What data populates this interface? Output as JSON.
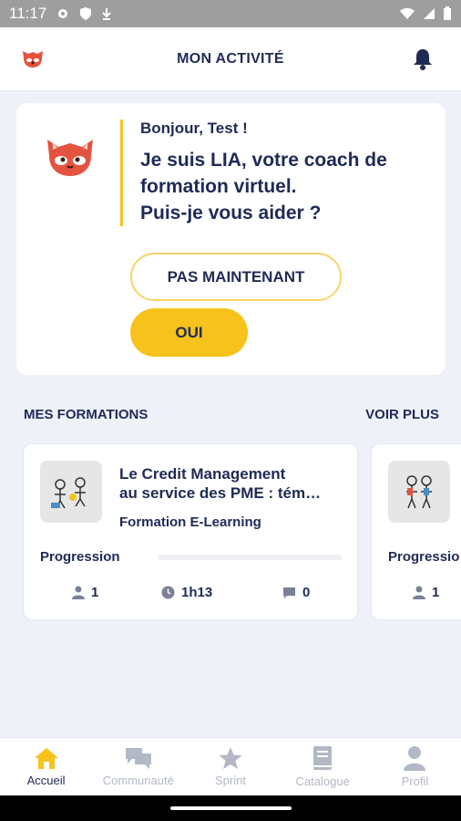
{
  "status_bar": {
    "time": "11:17",
    "icons": [
      "gear-icon",
      "shield-icon",
      "download-icon",
      "wifi-icon",
      "signal-icon",
      "battery-icon"
    ]
  },
  "header": {
    "title": "MON ACTIVITÉ",
    "logo_icon": "red-panda-logo",
    "notification_icon": "bell-icon"
  },
  "coach": {
    "greeting": "Bonjour, Test !",
    "message_line1": "Je suis LIA, votre coach de",
    "message_line2": "formation virtuel.",
    "message_line3": "Puis-je vous aider ?",
    "later_button": "PAS MAINTENANT",
    "yes_button": "OUI"
  },
  "formations": {
    "section_title": "MES FORMATIONS",
    "see_more": "VOIR PLUS",
    "cards": [
      {
        "title_line1": "Le Credit Management",
        "title_line2": "au service des PME : tém…",
        "type": "Formation E-Learning",
        "progress_label": "Progression",
        "progress": 0,
        "learners": "1",
        "duration": "1h13",
        "comments": "0"
      },
      {
        "title_line1": "",
        "title_line2": "",
        "type": "",
        "progress_label": "Progressio",
        "progress": 0,
        "learners": "1",
        "duration": "",
        "comments": ""
      }
    ]
  },
  "bottom_nav": {
    "items": [
      {
        "label": "Accueil",
        "icon": "home-icon",
        "active": true
      },
      {
        "label": "Communauté",
        "icon": "chat-icon",
        "active": false
      },
      {
        "label": "Sprint",
        "icon": "star-icon",
        "active": false
      },
      {
        "label": "Catalogue",
        "icon": "book-icon",
        "active": false
      },
      {
        "label": "Profil",
        "icon": "person-icon",
        "active": false
      }
    ]
  },
  "colors": {
    "accent": "#f7c21b",
    "text": "#1f2a56",
    "background": "#eef2f8",
    "inactive": "#b3b8c6"
  }
}
